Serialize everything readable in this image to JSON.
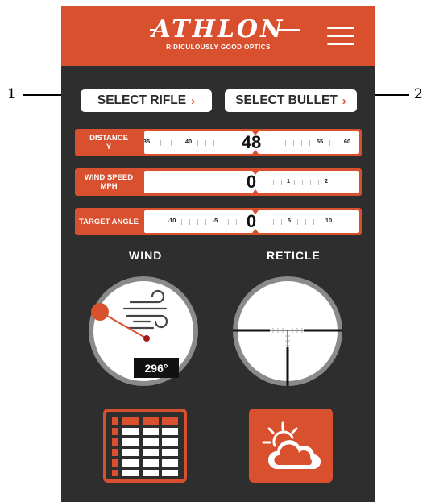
{
  "brand": {
    "name": "ATHLON",
    "tagline": "RIDICULOUSLY GOOD OPTICS"
  },
  "buttons": {
    "select_rifle": "SELECT RIFLE",
    "select_bullet": "SELECT BULLET"
  },
  "callouts": [
    "1",
    "2"
  ],
  "inputs": {
    "distance": {
      "label_line1": "DISTANCE",
      "label_line2": "Y",
      "value": "48",
      "ticks": [
        "35",
        "40",
        "55",
        "60"
      ]
    },
    "wind_speed": {
      "label_line1": "WIND SPEED",
      "label_line2": "MPH",
      "value": "0",
      "ticks": [
        "1",
        "2"
      ]
    },
    "target_angle": {
      "label_line1": "TARGET ANGLE",
      "label_line2": "",
      "value": "0",
      "ticks": [
        "-10",
        "-5",
        "5",
        "10"
      ]
    }
  },
  "wind": {
    "title": "WIND",
    "direction": "296°"
  },
  "reticle": {
    "title": "RETICLE"
  },
  "colors": {
    "accent": "#d9502f",
    "background": "#2e2e2e",
    "panel": "#ffffff"
  },
  "icons": [
    "menu-icon",
    "chevron-right-icon",
    "wind-icon",
    "table-icon",
    "weather-icon"
  ]
}
